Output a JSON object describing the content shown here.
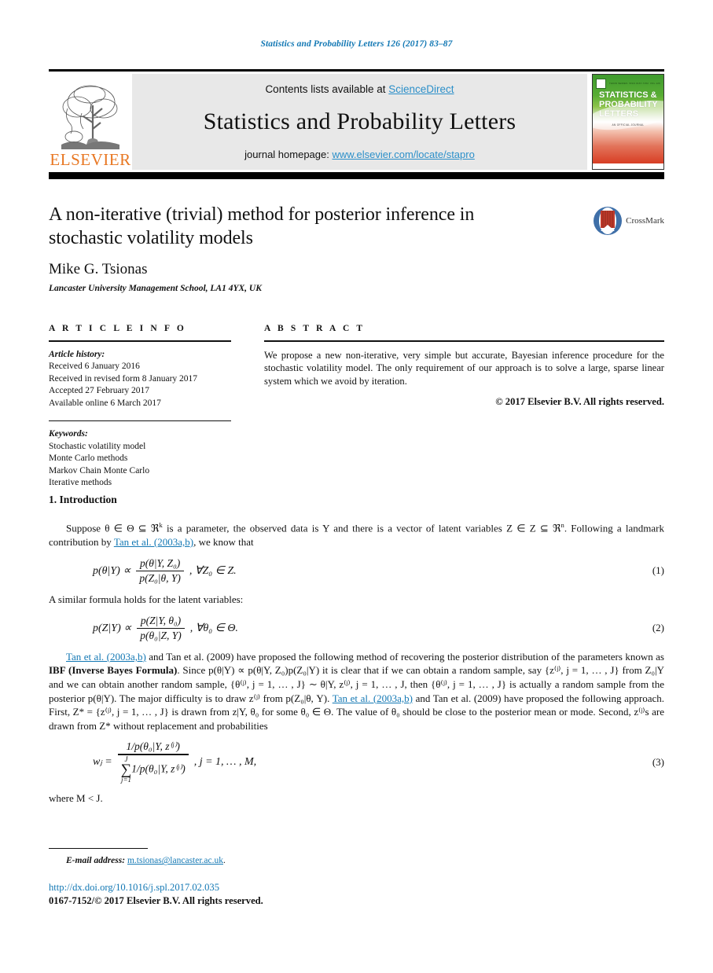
{
  "running_head": "Statistics and Probability Letters 126 (2017) 83–87",
  "masthead": {
    "contents_prefix": "Contents lists available at ",
    "contents_link": "ScienceDirect",
    "journal_name": "Statistics and Probability Letters",
    "homepage_prefix": "journal homepage: ",
    "homepage_link": "www.elsevier.com/locate/stapro",
    "publisher_wordmark": "ELSEVIER",
    "cover": {
      "title_line1": "STATISTICS &",
      "title_line2": "PROBABILITY",
      "title_line3": "LETTERS",
      "top_left": "THIRD SERIES",
      "top_mid": "ISSN 0167-7152",
      "top_right": "VOL 126",
      "subtitle": "AN OFFICIAL JOURNAL"
    }
  },
  "title_block": {
    "title": "A non-iterative (trivial) method for posterior inference in stochastic volatility models",
    "author": "Mike G. Tsionas",
    "affiliation": "Lancaster University Management School, LA1 4YX, UK",
    "crossmark_label": "CrossMark"
  },
  "article_info": {
    "heading": "A R T I C L E   I N F O",
    "history_label": "Article history:",
    "history": [
      "Received 6 January 2016",
      "Received in revised form 8 January 2017",
      "Accepted 27 February 2017",
      "Available online 6 March 2017"
    ],
    "keywords_label": "Keywords:",
    "keywords": [
      "Stochastic volatility model",
      "Monte Carlo methods",
      "Markov Chain Monte Carlo",
      "Iterative methods"
    ]
  },
  "abstract": {
    "heading": "A B S T R A C T",
    "text": "We propose a new non-iterative, very simple but accurate, Bayesian inference procedure for the stochastic volatility model. The only requirement of our approach is to solve a large, sparse linear system which we avoid by iteration.",
    "copyright": "© 2017 Elsevier B.V. All rights reserved."
  },
  "body": {
    "section_heading": "1. Introduction",
    "para1_a": "Suppose θ ∈ Θ ⊆ ℜ",
    "para1_sup": "k",
    "para1_b": " is a parameter, the observed data is Y and there is a vector of latent variables Z ∈ Z ⊆ ℜ",
    "para1_sup2": "n",
    "para1_c": ". Following a landmark contribution by ",
    "para1_link": "Tan et al. (2003a,b)",
    "para1_d": ", we know that",
    "eq1": {
      "lhs": "p(θ|Y) ∝",
      "num": "p(θ|Y, Z₀)",
      "den": "p(Z₀|θ, Y)",
      "tail": ",    ∀Z₀ ∈ Z.",
      "number": "(1)"
    },
    "para2": "A similar formula holds for the latent variables:",
    "eq2": {
      "lhs": "p(Z|Y) ∝",
      "num": "p(Z|Y, θ₀)",
      "den": "p(θ₀|Z, Y)",
      "tail": ",    ∀θ₀ ∈ Θ.",
      "number": "(2)"
    },
    "para3_link1": "Tan et al. (2003a,b)",
    "para3_a": " and Tan et al. (2009) have proposed the following method of recovering the posterior distribution of the parameters known as ",
    "para3_bold": "IBF (Inverse Bayes Formula)",
    "para3_b": ". Since p(θ|Y) ∝ p(θ|Y, Z₀)p(Z₀|Y) it is clear that if we can obtain a random sample, say {z⁽ʲ⁾, j = 1, … , J} from Z₀|Y and we can obtain another random sample, {θ⁽ʲ⁾, j = 1, … , J} ∼ θ|Y, z⁽ʲ⁾, j = 1, … , J, then {θ⁽ʲ⁾, j = 1, … , J} is actually a random sample from the posterior p(θ|Y). The major difficulty is to draw z⁽ʲ⁾ from p(Z₀|θ, Y). ",
    "para3_link2": "Tan et al. (2003a,b)",
    "para3_c": " and Tan et al. (2009) have proposed the following approach. First, Z* = {z⁽ʲ⁾, j = 1, … , J} is drawn from z|Y, θ₀ for some θ₀ ∈ Θ. The value of θ₀ should be close to the posterior mean or mode. Second, z⁽ʲ⁾s are drawn from Z* without replacement and probabilities",
    "eq3": {
      "lhs": "wⱼ =",
      "num": "1/p(θ₀|Y, z⁽ʲ⁾)",
      "sum_top": "J",
      "sum_bottom": "j=1",
      "den_tail": "1/p(θ₀|Y, z⁽ʲ⁾)",
      "tail": ",    j = 1, … , M,",
      "number": "(3)"
    },
    "para4": "where M < J."
  },
  "footer": {
    "email_label": "E-mail address:",
    "email": "m.tsionas@lancaster.ac.uk",
    "email_suffix": ".",
    "doi": "http://dx.doi.org/10.1016/j.spl.2017.02.035",
    "issn": "0167-7152/© 2017 Elsevier B.V. All rights reserved."
  },
  "colors": {
    "link": "#1378b4",
    "masthead_link": "#2b8fc9",
    "elsevier_orange": "#e87722"
  }
}
